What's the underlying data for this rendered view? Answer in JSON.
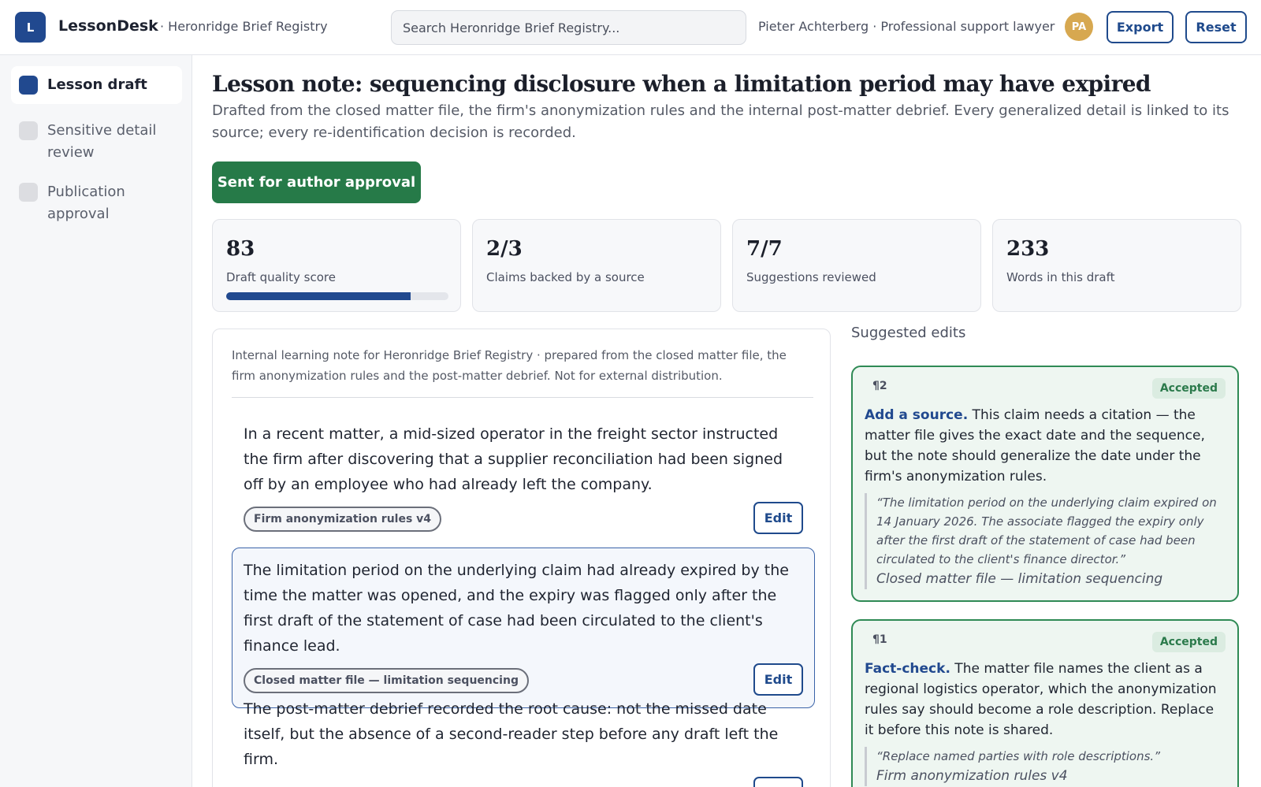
{
  "app": {
    "logo_letter": "L",
    "name": "LessonDesk",
    "registry": "· Heronridge Brief Registry"
  },
  "search": {
    "placeholder": "Search Heronridge Brief Registry..."
  },
  "user": {
    "label": "Pieter Achterberg · Professional support lawyer",
    "initials": "PA"
  },
  "toolbar": {
    "export_label": "Export",
    "reset_label": "Reset"
  },
  "sidebar": {
    "items": [
      {
        "label": "Lesson draft",
        "active": true
      },
      {
        "label": "Sensitive detail review",
        "active": false
      },
      {
        "label": "Publication approval",
        "active": false
      }
    ]
  },
  "main": {
    "title": "Lesson note: sequencing disclosure when a limitation period may have expired",
    "subtitle": "Drafted from the closed matter file, the firm's anonymization rules and the internal post-matter debrief. Every generalized detail is linked to its source; every re-identification decision is recorded.",
    "status_label": "Sent for author approval"
  },
  "stats": [
    {
      "value": "83",
      "label": "Draft quality score",
      "progress": 0.83
    },
    {
      "value": "2/3",
      "label": "Claims backed by a source"
    },
    {
      "value": "7/7",
      "label": "Suggestions reviewed"
    },
    {
      "value": "233",
      "label": "Words in this draft"
    }
  ],
  "document": {
    "header": "Internal learning note for Heronridge Brief Registry · prepared from the closed matter file, the firm anonymization rules and the post-matter debrief. Not for external distribution.",
    "paragraphs": [
      {
        "text": "In a recent matter, a mid-sized operator in the freight sector instructed the firm after discovering that a supplier reconciliation had been signed off by an employee who had already left the company.",
        "source": "Firm anonymization rules v4",
        "edit_label": "Edit"
      },
      {
        "text": "The limitation period on the underlying claim had already expired by the time the matter was opened, and the expiry was flagged only after the first draft of the statement of case had been circulated to the client's finance lead.",
        "source": "Closed matter file — limitation sequencing",
        "edit_label": "Edit"
      },
      {
        "text": "The post-matter debrief recorded the root cause: not the missed date itself, but the absence of a second-reader step before any draft left the firm.",
        "edit_label": "Edit"
      }
    ]
  },
  "suggestions": {
    "title": "Suggested edits",
    "items": [
      {
        "para_ref": "¶2",
        "status": "Accepted",
        "kind": "Add a source.",
        "body": " This claim needs a citation — the matter file gives the exact date and the sequence, but the note should generalize the date under the firm's anonymization rules.",
        "quote": "“The limitation period on the underlying claim expired on 14 January 2026. The associate flagged the expiry only after the first draft of the statement of case had been circulated to the client's finance director.”",
        "quote_source": "Closed matter file — limitation sequencing"
      },
      {
        "para_ref": "¶1",
        "status": "Accepted",
        "kind": "Fact-check.",
        "body": " The matter file names the client as a regional logistics operator, which the anonymization rules say should become a role description. Replace it before this note is shared.",
        "quote": "“Replace named parties with role descriptions.”",
        "quote_source": "Firm anonymization rules v4"
      }
    ]
  },
  "colors": {
    "accent": "#21498f",
    "success": "#267a48",
    "avatar": "#d7a850"
  }
}
